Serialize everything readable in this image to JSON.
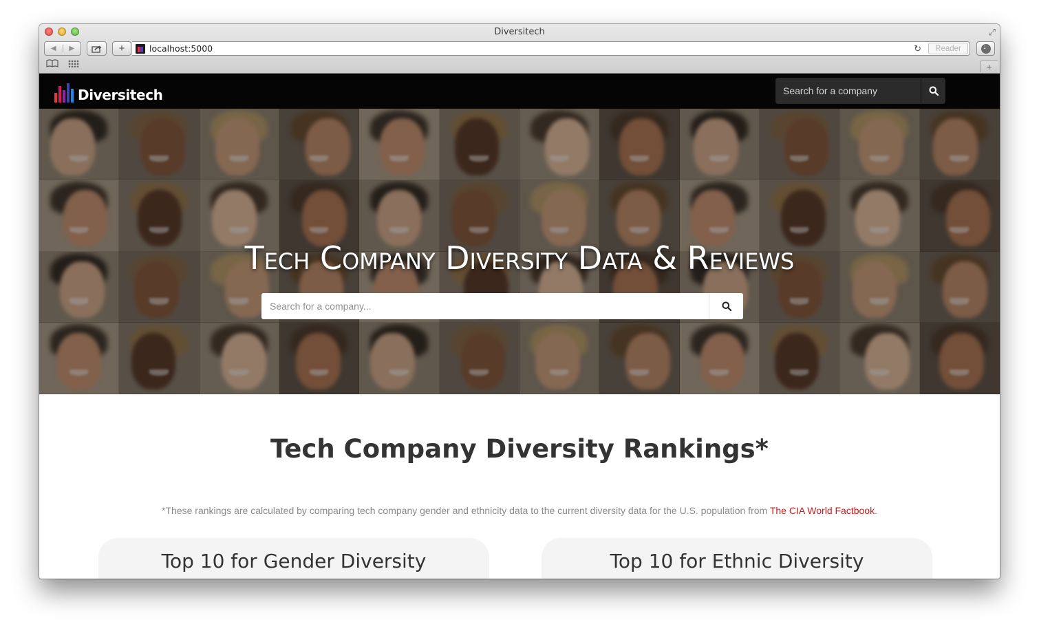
{
  "browser": {
    "window_title": "Diversitech",
    "url": "localhost:5000",
    "reader_label": "Reader",
    "icons": [
      "back-arrow-icon",
      "forward-arrow-icon",
      "share-icon",
      "plus-icon",
      "reload-icon",
      "downloads-icon",
      "bookmarks-book-icon",
      "top-sites-grid-icon",
      "new-tab-plus-icon",
      "fullscreen-icon"
    ]
  },
  "navbar": {
    "brand_name": "Diversitech",
    "brand_colors": [
      "#e53935",
      "#d81b60",
      "#8e24aa",
      "#3949ab",
      "#1e88e5"
    ],
    "search_placeholder": "Search for a company"
  },
  "hero": {
    "title": "Tech Company Diversity Data & Reviews",
    "search_placeholder": "Search for a company..."
  },
  "rankings": {
    "title": "Tech Company Diversity Rankings*",
    "footnote_text": "*These rankings are calculated by comparing tech company gender and ethnicity data to the current diversity data for the U.S. population from ",
    "footnote_link": "The CIA World Factbook",
    "footnote_end": ".",
    "cards": [
      {
        "title": "Top 10 for Gender Diversity"
      },
      {
        "title": "Top 10 for Ethnic Diversity"
      }
    ]
  },
  "colors": {
    "navbar_bg": "#050505",
    "link_red": "#c81b1b",
    "card_bg": "#f4f4f4"
  }
}
